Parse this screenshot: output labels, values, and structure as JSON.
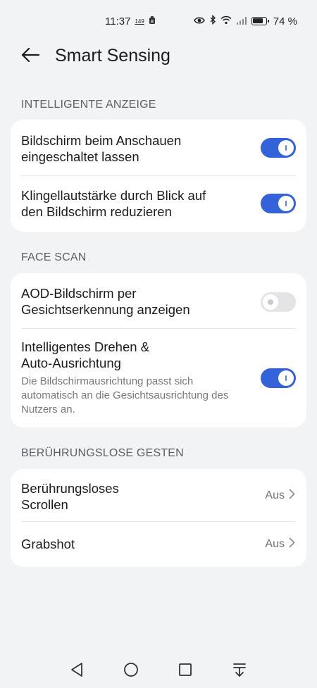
{
  "status_bar": {
    "time": "11:37",
    "notif_badge": "149",
    "battery_text": "74 %",
    "icons": [
      "eye-icon",
      "bluetooth-icon",
      "wifi-icon",
      "signal-icon",
      "battery-icon"
    ]
  },
  "header": {
    "title": "Smart Sensing",
    "back_icon": "arrow-left-icon"
  },
  "sections": {
    "intelligent_display": {
      "label": "INTELLIGENTE ANZEIGE",
      "items": [
        {
          "title_line1": "Bildschirm beim Anschauen",
          "title_line2": "eingeschaltet lassen",
          "toggle": true
        },
        {
          "title_line1": "Klingellautstärke durch Blick auf",
          "title_line2": "den Bildschirm reduzieren",
          "toggle": true
        }
      ]
    },
    "face_scan": {
      "label": "FACE SCAN",
      "items": [
        {
          "title_line1": "AOD-Bildschirm per",
          "title_line2": "Gesichtserkennung anzeigen",
          "toggle": false
        },
        {
          "title_line1": "Intelligentes Drehen &",
          "title_line2": "Auto-Ausrichtung",
          "subtitle": "Die Bildschirmausrichtung passt sich automatisch an die Gesichtsausrichtung des Nutzers an.",
          "toggle": true
        }
      ]
    },
    "touchless_gestures": {
      "label": "BERÜHRUNGSLOSE GESTEN",
      "items": [
        {
          "title_line1": "Berührungsloses",
          "title_line2": "Scrollen",
          "value": "Aus"
        },
        {
          "title_line1": "Grabshot",
          "value": "Aus"
        }
      ]
    }
  },
  "nav_bar": {
    "buttons": [
      "back-triangle-icon",
      "home-circle-icon",
      "recents-square-icon",
      "notification-pull-icon"
    ]
  },
  "colors": {
    "accent": "#3462d8",
    "background": "#f1f3f5",
    "card": "#ffffff",
    "toggle_off": "#e3e4e6"
  }
}
